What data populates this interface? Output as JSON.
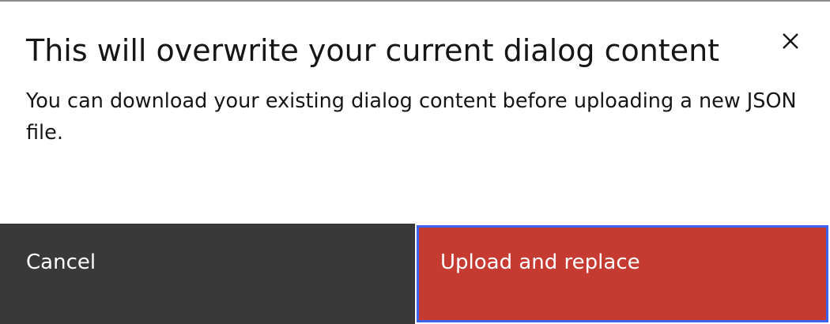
{
  "dialog": {
    "title": "This will overwrite your current dialog content",
    "body": "You can download your existing dialog content before uploading a new JSON file.",
    "close_icon": "close-icon"
  },
  "actions": {
    "cancel_label": "Cancel",
    "confirm_label": "Upload and replace"
  },
  "colors": {
    "cancel_bg": "#393939",
    "danger_bg": "#c53a31",
    "focus_ring": "#3d63f2",
    "text": "#161616"
  }
}
